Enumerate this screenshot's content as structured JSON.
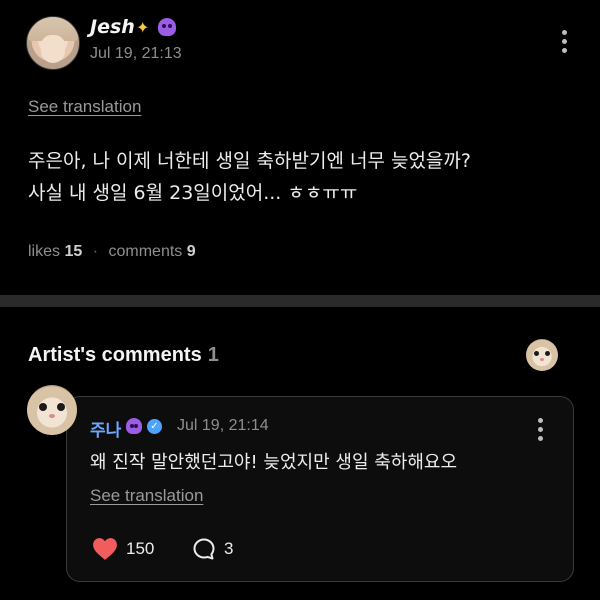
{
  "post": {
    "author": "Jesh",
    "author_emojis": [
      "comet-emoji",
      "alien-monster-emoji"
    ],
    "timestamp": "Jul 19, 21:13",
    "see_translation": "See translation",
    "body_line1": "주은아, 나 이제 너한테 생일 축하받기엔 너무 늦었을까?",
    "body_line2": "사실 내 생일 6월 23일이었어... ㅎㅎㅠㅠ",
    "likes_label": "likes",
    "likes_count": "15",
    "comments_label": "comments",
    "comments_count": "9",
    "separator": "·"
  },
  "artist_comments": {
    "title": "Artist's comments",
    "count": "1"
  },
  "comment": {
    "author": "주나",
    "timestamp": "Jul 19, 21:14",
    "body": "왜 진작 말안했던고야! 늦었지만 생일 축하해요오",
    "see_translation": "See translation",
    "likes": "150",
    "replies": "3"
  },
  "colors": {
    "background": "#000000",
    "divider": "#2a2a2a",
    "artist_name": "#6da8ff",
    "heart": "#f25c5c",
    "verified": "#4fa3ff"
  }
}
